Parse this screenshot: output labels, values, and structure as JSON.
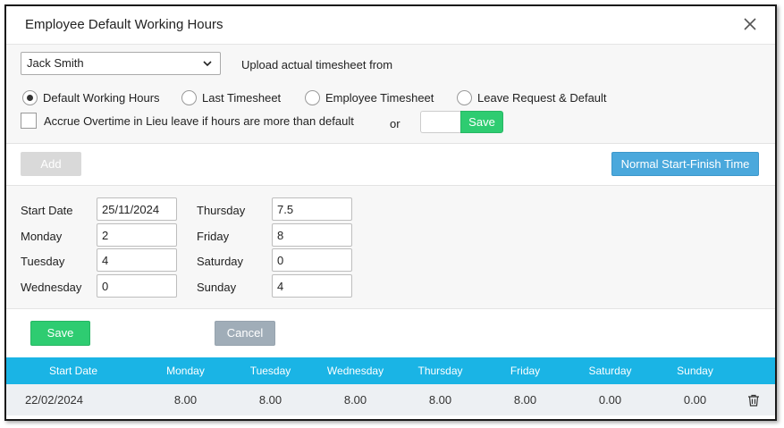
{
  "dialog": {
    "title": "Employee Default Working Hours",
    "close_icon": "close-icon"
  },
  "selection": {
    "employee": "Jack Smith",
    "upload_label": "Upload actual timesheet from",
    "radios": [
      {
        "label": "Default Working Hours",
        "checked": true
      },
      {
        "label": "Last Timesheet",
        "checked": false
      },
      {
        "label": "Employee Timesheet",
        "checked": false
      },
      {
        "label": "Leave Request & Default",
        "checked": false
      }
    ],
    "accrue_label": "Accrue Overtime in Lieu leave if hours are more than default",
    "accrue_checked": false,
    "or_label": "or",
    "timesheet_input_value": "",
    "save_label": "Save"
  },
  "toolbar": {
    "add_label": "Add",
    "normal_time_label": "Normal Start-Finish Time"
  },
  "form": {
    "labels": {
      "start_date": "Start Date",
      "monday": "Monday",
      "tuesday": "Tuesday",
      "wednesday": "Wednesday",
      "thursday": "Thursday",
      "friday": "Friday",
      "saturday": "Saturday",
      "sunday": "Sunday"
    },
    "values": {
      "start_date": "25/11/2024",
      "monday": "2",
      "tuesday": "4",
      "wednesday": "0",
      "thursday": "7.5",
      "friday": "8",
      "saturday": "0",
      "sunday": "4"
    },
    "save_label": "Save",
    "cancel_label": "Cancel"
  },
  "table": {
    "headers": [
      "Start Date",
      "Monday",
      "Tuesday",
      "Wednesday",
      "Thursday",
      "Friday",
      "Saturday",
      "Sunday"
    ],
    "rows": [
      {
        "cells": [
          "22/02/2024",
          "8.00",
          "8.00",
          "8.00",
          "8.00",
          "8.00",
          "0.00",
          "0.00"
        ],
        "action_icon": "trash-icon"
      }
    ]
  },
  "colors": {
    "accent_green": "#2ecc71",
    "accent_blue": "#4aa8dc",
    "table_header": "#1ab4e5"
  }
}
